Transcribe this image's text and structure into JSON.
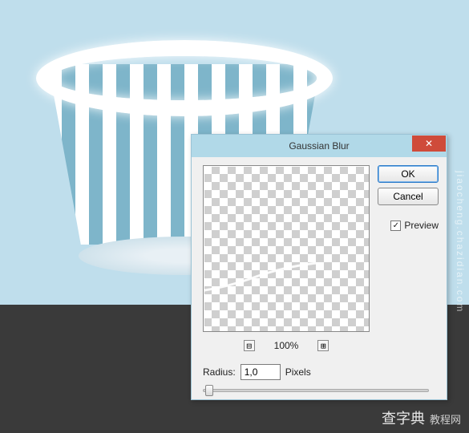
{
  "dialog": {
    "title": "Gaussian Blur",
    "ok_label": "OK",
    "cancel_label": "Cancel",
    "preview_label": "Preview",
    "preview_checked": true,
    "zoom_out_glyph": "⊟",
    "zoom_in_glyph": "⊞",
    "zoom_level": "100%",
    "radius_label": "Radius:",
    "radius_value": "1,0",
    "radius_unit": "Pixels",
    "close_glyph": "✕"
  },
  "watermark": {
    "brand": "查字典",
    "brand_suffix": "教程网",
    "url": "jiaocheng.chazidian.com"
  }
}
